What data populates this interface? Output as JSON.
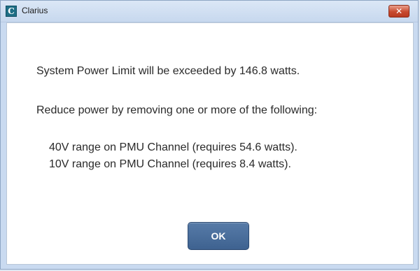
{
  "window": {
    "title": "Clarius",
    "app_icon_glyph": "C",
    "close_glyph": "✕"
  },
  "dialog": {
    "message": "System Power Limit will be exceeded by 146.8 watts.",
    "instruction": "Reduce power by removing one or more of the following:",
    "items": [
      "40V range on PMU Channel (requires 54.6 watts).",
      "10V range on PMU Channel (requires 8.4 watts)."
    ],
    "ok_label": "OK"
  },
  "colors": {
    "ok_button": "#4a6e9d",
    "close_button": "#c84a2f",
    "titlebar": "#d3e1f3"
  }
}
